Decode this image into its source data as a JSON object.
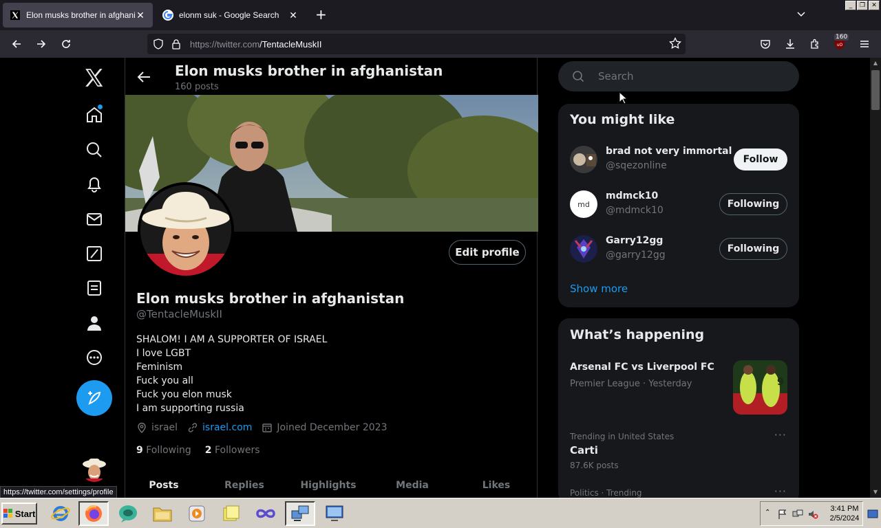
{
  "browser": {
    "tabs": [
      {
        "title": "Elon musks brother in afghanistan",
        "active": true
      },
      {
        "title": "elonm suk - Google Search",
        "active": false
      }
    ],
    "url_host": "https://twitter.com",
    "url_path": "/TentacleMuskII",
    "badge": "160",
    "status_url": "https://twitter.com/settings/profile"
  },
  "profile_header": {
    "name": "Elon musks brother in afghanistan",
    "posts": "160 posts"
  },
  "profile": {
    "edit_label": "Edit profile",
    "name": "Elon musks brother in afghanistan",
    "handle": "@TentacleMuskII",
    "bio": [
      "SHALOM! I AM A SUPPORTER OF ISRAEL",
      "I love LGBT",
      "Feminism",
      "Fuck you all",
      "Fuck you elon musk",
      "I am supporting russia"
    ],
    "location": "israel",
    "link": "israel.com",
    "joined": "Joined December 2023",
    "following_count": "9",
    "following_label": "Following",
    "followers_count": "2",
    "followers_label": "Followers",
    "tabs": [
      "Posts",
      "Replies",
      "Highlights",
      "Media",
      "Likes"
    ]
  },
  "search": {
    "placeholder": "Search"
  },
  "you_might_like": {
    "title": "You might like",
    "users": [
      {
        "name": "brad not very immortal",
        "handle": "@sqezonline",
        "button": "Follow"
      },
      {
        "name": "mdmck10",
        "handle": "@mdmck10",
        "button": "Following",
        "avatar_text": "md"
      },
      {
        "name": "Garry12gg",
        "handle": "@garry12gg",
        "button": "Following"
      }
    ],
    "show_more": "Show more"
  },
  "whats_happening": {
    "title": "What’s happening",
    "event": {
      "name": "Arsenal FC vs Liverpool FC",
      "context": "Premier League · Yesterday"
    },
    "trends": [
      {
        "context": "Trending in United States",
        "name": "Carti",
        "count": "87.6K posts"
      },
      {
        "context": "Politics · Trending"
      }
    ]
  },
  "taskbar": {
    "start": "Start",
    "time": "3:41 PM",
    "date": "2/5/2024"
  },
  "colors": {
    "accent": "#1d9bf0",
    "background": "#000000",
    "card": "#16181c"
  }
}
